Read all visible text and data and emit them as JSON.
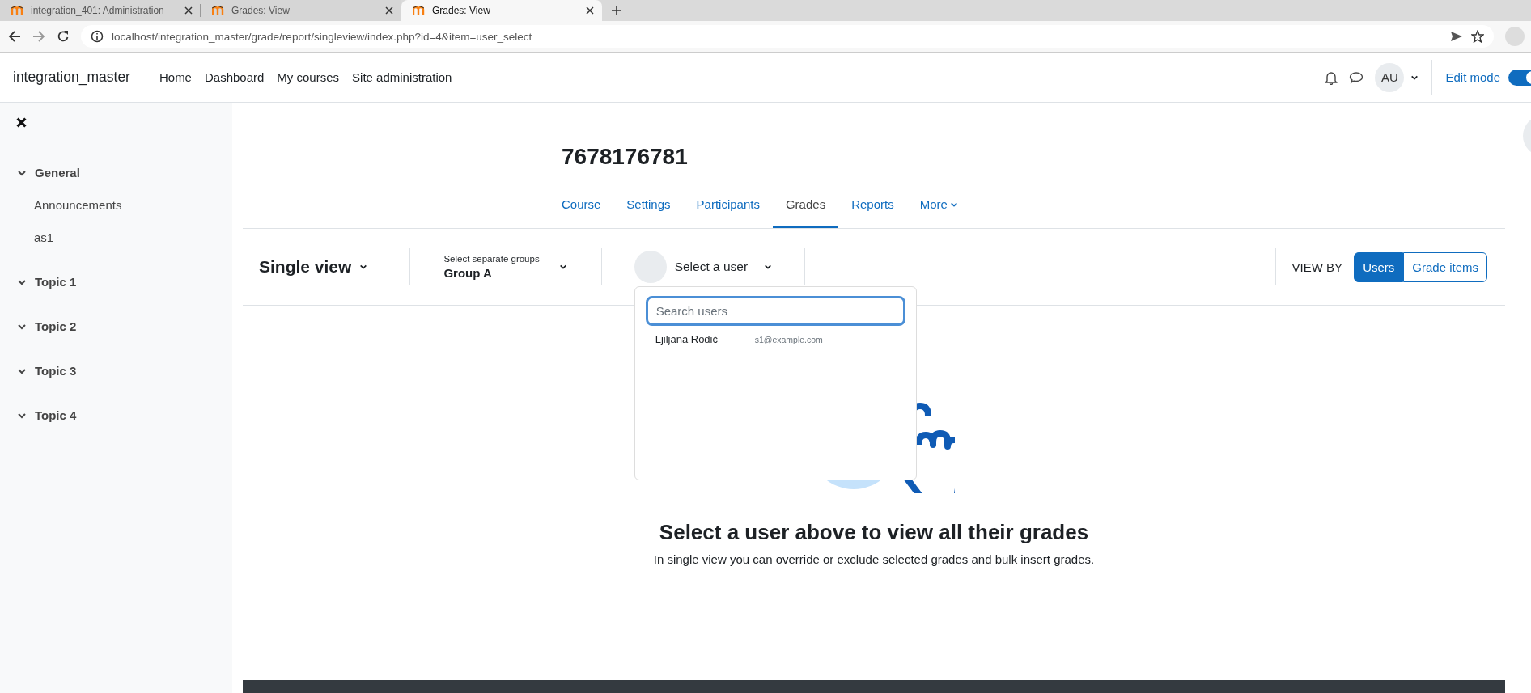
{
  "browser": {
    "tabs": [
      {
        "title": "integration_401: Administration",
        "selected": false
      },
      {
        "title": "Grades: View",
        "selected": false
      },
      {
        "title": "Grades: View",
        "selected": true
      }
    ],
    "address": "localhost/integration_master/grade/report/singleview/index.php?id=4&item=user_select"
  },
  "navbar": {
    "site_name": "integration_master",
    "links": [
      "Home",
      "Dashboard",
      "My courses",
      "Site administration"
    ],
    "avatar": "AU",
    "edit_mode": {
      "label": "Edit mode",
      "on": true
    }
  },
  "sidebar": {
    "sections": [
      {
        "label": "General",
        "expanded": true,
        "children": [
          {
            "label": "Announcements"
          },
          {
            "label": "as1"
          }
        ]
      },
      {
        "label": "Topic 1",
        "expanded": true
      },
      {
        "label": "Topic 2",
        "expanded": true
      },
      {
        "label": "Topic 3",
        "expanded": true
      },
      {
        "label": "Topic 4",
        "expanded": true
      }
    ]
  },
  "course": {
    "title": "7678176781",
    "tabs": [
      {
        "label": "Course",
        "selected": false,
        "menu": false
      },
      {
        "label": "Settings",
        "selected": false,
        "menu": false
      },
      {
        "label": "Participants",
        "selected": false,
        "menu": false
      },
      {
        "label": "Grades",
        "selected": true,
        "menu": false
      },
      {
        "label": "Reports",
        "selected": false,
        "menu": false
      },
      {
        "label": "More",
        "selected": false,
        "menu": true
      }
    ]
  },
  "tertiary": {
    "report": "Single view",
    "group": {
      "label": "Select separate groups",
      "value": "Group A"
    },
    "user": {
      "label": "Select a user"
    },
    "view_by": {
      "label": "VIEW BY",
      "options": [
        {
          "label": "Users",
          "selected": true
        },
        {
          "label": "Grade items",
          "selected": false
        }
      ]
    }
  },
  "user_dropdown": {
    "search": {
      "placeholder": "Search users"
    },
    "users": [
      {
        "name": "Ljiljana Rodić",
        "email": "s1@example.com"
      }
    ]
  },
  "empty_state": {
    "heading": "Select a user above to view all their grades",
    "text": "In single view you can override or exclude selected grades and bulk insert grades."
  }
}
